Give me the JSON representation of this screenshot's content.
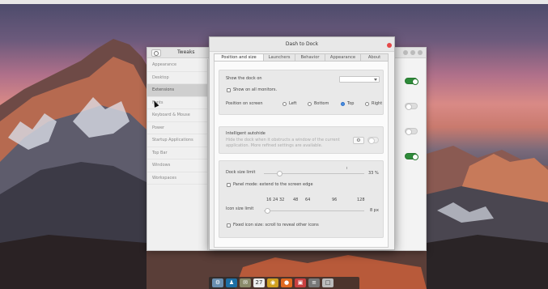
{
  "desktop": {
    "top_title": "Dash to Dock"
  },
  "tweaks": {
    "title": "Tweaks",
    "sidebar": [
      "Appearance",
      "Desktop",
      "Extensions",
      "Fonts",
      "Keyboard & Mouse",
      "Power",
      "Startup Applications",
      "Top Bar",
      "Windows",
      "Workspaces"
    ],
    "active_index": 2,
    "toggles": [
      true,
      false,
      false,
      true
    ]
  },
  "dialog": {
    "title": "Dash to Dock",
    "tabs": [
      "Position and size",
      "Launchers",
      "Behavior",
      "Appearance",
      "About"
    ],
    "active_tab": 0,
    "position": {
      "show_dock_on_label": "Show the dock on",
      "monitor_value": "",
      "all_monitors_label": "Show on all monitors.",
      "position_label": "Position on screen",
      "options": [
        "Left",
        "Bottom",
        "Top",
        "Right"
      ],
      "selected": "Top"
    },
    "autohide": {
      "title": "Intelligent autohide",
      "description_1": "Hide the dock when it obstructs a window of the current",
      "description_2": "application. More refined settings are available.",
      "settings_icon": "gear-icon"
    },
    "size": {
      "dock_size_label": "Dock size limit",
      "dock_size_value": "33 %",
      "dock_size_fraction": 0.04,
      "panel_mode_label": "Panel mode: extend to the screen edge",
      "icon_size_label": "Icon size limit",
      "icon_ticks": [
        "16",
        "24",
        "32",
        "48",
        "64",
        "96",
        "128"
      ],
      "icon_size_value": "8 px",
      "icon_size_fraction": 0.0,
      "fixed_icon_label": "Fixed icon size: scroll to reveal other icons"
    }
  },
  "dock_icons": [
    "⚙",
    "♟",
    "✉",
    "27",
    "◉",
    "●",
    "▣",
    "≡",
    "□"
  ],
  "colors": {
    "accent": "#4a8fe0",
    "toggle_on": "#2e8b3a",
    "close": "#e54848"
  }
}
